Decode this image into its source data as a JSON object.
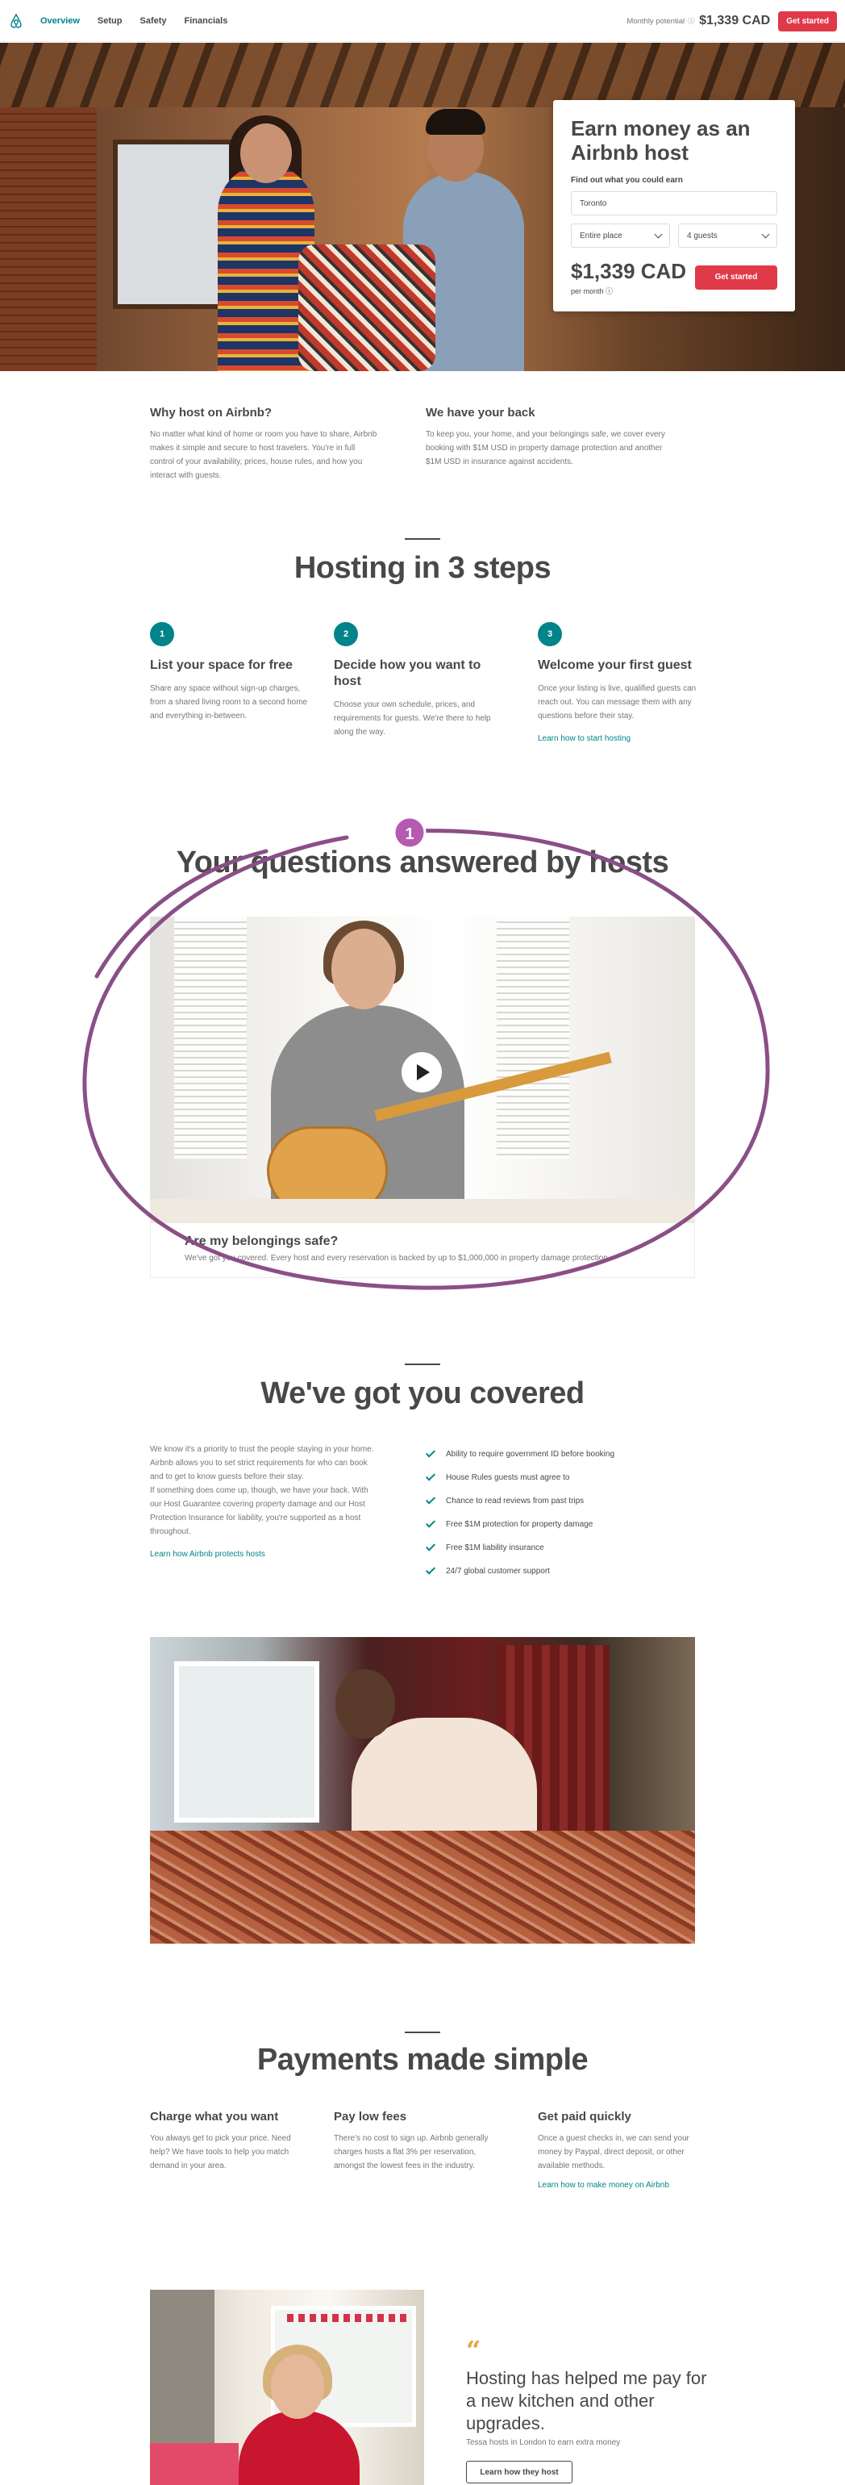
{
  "nav": {
    "logo_icon": "airbnb-logo-icon",
    "links": [
      "Overview",
      "Setup",
      "Safety",
      "Financials"
    ],
    "monthly_potential_label": "Monthly potential",
    "monthly_potential_value": "$1,339 CAD",
    "get_started": "Get started"
  },
  "earn": {
    "title": "Earn money as an Airbnb host",
    "subtitle": "Find out what you could earn",
    "city": "Toronto",
    "place_type": "Entire place",
    "guests": "4 guests",
    "amount": "$1,339 CAD",
    "per": "per month",
    "cta": "Get started"
  },
  "why": {
    "left_title": "Why host on Airbnb?",
    "left_text": "No matter what kind of home or room you have to share, Airbnb makes it simple and secure to host travelers. You're in full control of your availability, prices, house rules, and how you interact with guests.",
    "right_title": "We have your back",
    "right_text": "To keep you, your home, and your belongings safe, we cover every booking with $1M USD in property damage protection and another $1M USD in insurance against accidents."
  },
  "steps": {
    "title": "Hosting in 3 steps",
    "items": [
      {
        "num": "1",
        "title": "List your space for free",
        "text": "Share any space without sign-up charges, from a shared living room to a second home and everything in-between."
      },
      {
        "num": "2",
        "title": "Decide how you want to host",
        "text": "Choose your own schedule, prices, and requirements for guests. We're there to help along the way."
      },
      {
        "num": "3",
        "title": "Welcome your first guest",
        "text": "Once your listing is live, qualified guests can reach out. You can message them with any questions before their stay."
      }
    ],
    "link": "Learn how to start hosting"
  },
  "questions": {
    "title": "Your questions answered by hosts",
    "annotation_number": "1",
    "annotation_color": "#8a4f86",
    "video_caption_title": "Are my belongings safe?",
    "video_caption_text": "We've got you covered. Every host and every reservation is backed by up to $1,000,000 in property damage protection."
  },
  "covered": {
    "title": "We've got you covered",
    "text1": "We know it's a priority to trust the people staying in your home. Airbnb allows you to set strict requirements for who can book and to get to know guests before their stay.",
    "text2": "If something does come up, though, we have your back. With our Host Guarantee covering property damage and our Host Protection Insurance for liability, you're supported as a host throughout.",
    "link": "Learn how Airbnb protects hosts",
    "items": [
      "Ability to require government ID before booking",
      "House Rules guests must agree to",
      "Chance to read reviews from past trips",
      "Free $1M protection for property damage",
      "Free $1M liability insurance",
      "24/7 global customer support"
    ]
  },
  "payments": {
    "title": "Payments made simple",
    "items": [
      {
        "title": "Charge what you want",
        "text": "You always get to pick your price. Need help? We have tools to help you match demand in your area."
      },
      {
        "title": "Pay low fees",
        "text": "There's no cost to sign up. Airbnb generally charges hosts a flat 3% per reservation, amongst the lowest fees in the industry."
      },
      {
        "title": "Get paid quickly",
        "text": "Once a guest checks in, we can send your money by Paypal, direct deposit, or other available methods."
      }
    ],
    "link": "Learn how to make money on Airbnb"
  },
  "testimonial": {
    "quote_mark": "“",
    "quote": "Hosting has helped me pay for a new kitchen and other upgrades.",
    "by": "Tessa hosts in London to earn extra money",
    "button": "Learn how they host"
  },
  "colors": {
    "teal": "#008489",
    "red": "#e0394a",
    "text": "#484848",
    "muted": "#767676"
  }
}
